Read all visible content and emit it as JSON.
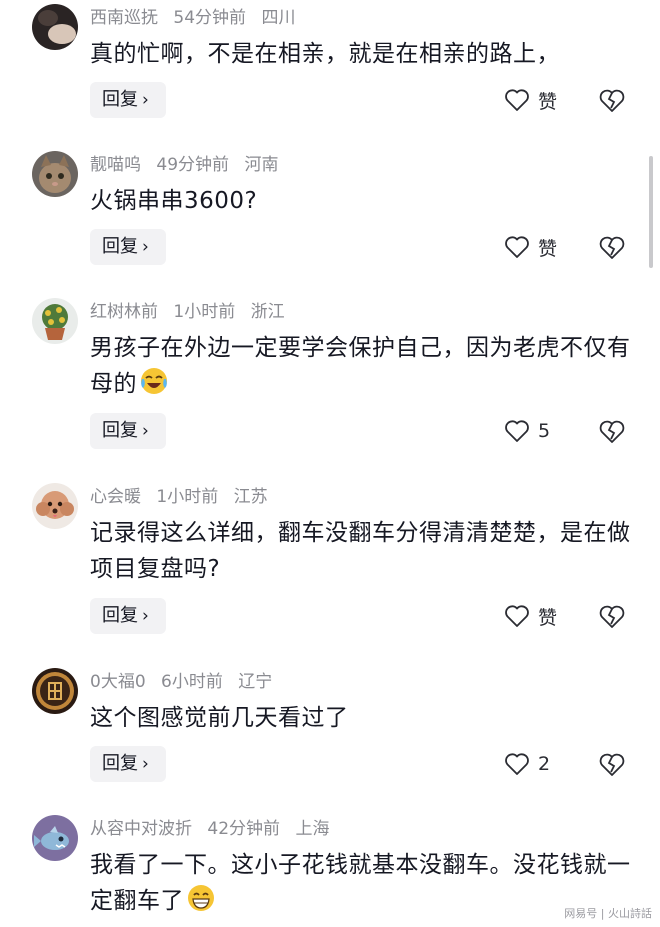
{
  "comments": [
    {
      "username": "西南巡抚",
      "time": "54分钟前",
      "location": "四川",
      "text": "真的忙啊，不是在相亲，就是在相亲的路上，",
      "reply_label": "回复",
      "like_label": "赞",
      "avatar_icon": "avatar-dark-photo"
    },
    {
      "username": "靓喵呜",
      "time": "49分钟前",
      "location": "河南",
      "text": "火锅串串3600?",
      "reply_label": "回复",
      "like_label": "赞",
      "avatar_icon": "avatar-cat"
    },
    {
      "username": "红树林前",
      "time": "1小时前",
      "location": "浙江",
      "text": "男孩子在外边一定要学会保护自己，因为老虎不仅有母的",
      "emoji": "laughing-crying-emoji",
      "reply_label": "回复",
      "like_label": "5",
      "avatar_icon": "avatar-potted-plant"
    },
    {
      "username": "心会暖",
      "time": "1小时前",
      "location": "江苏",
      "text": "记录得这么详细，翻车没翻车分得清清楚楚，是在做项目复盘吗?",
      "reply_label": "回复",
      "like_label": "赞",
      "avatar_icon": "avatar-poodle"
    },
    {
      "username": "0大福0",
      "time": "6小时前",
      "location": "辽宁",
      "text": "这个图感觉前几天看过了",
      "reply_label": "回复",
      "like_label": "2",
      "avatar_icon": "avatar-fortune-coin"
    },
    {
      "username": "从容中对波折",
      "time": "42分钟前",
      "location": "上海",
      "text": "我看了一下。这小子花钱就基本没翻车。没花钱就一定翻车了",
      "emoji": "grinning-emoji",
      "avatar_icon": "avatar-cartoon-fish"
    }
  ],
  "watermark": "网易号 | 火山詩話"
}
